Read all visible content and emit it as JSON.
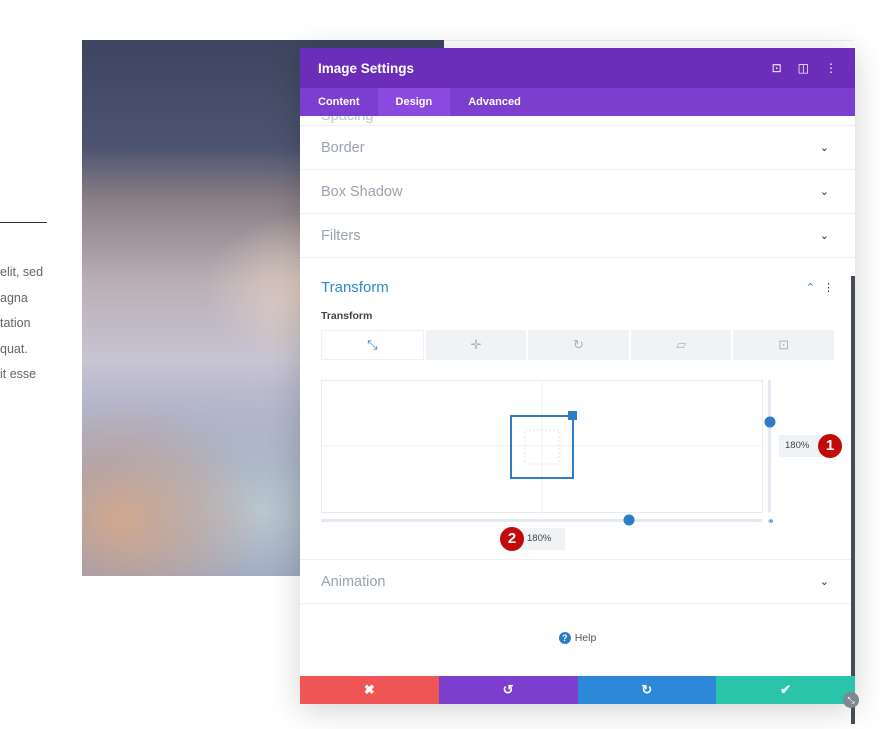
{
  "background": {
    "body_lines": [
      "elit, sed",
      "agna",
      "tation",
      "quat.",
      "it esse"
    ]
  },
  "modal": {
    "title": "Image Settings",
    "header_icons": [
      "focus-icon",
      "sidebar-layout-icon",
      "more-vertical-icon"
    ],
    "tabs": [
      {
        "label": "Content"
      },
      {
        "label": "Design",
        "active": true
      },
      {
        "label": "Advanced"
      }
    ],
    "sections": {
      "spacing": "Spacing",
      "border": "Border",
      "box_shadow": "Box Shadow",
      "filters": "Filters",
      "transform": "Transform",
      "animation": "Animation"
    },
    "transform": {
      "sub_label": "Transform",
      "tool_tabs": [
        "scale-icon",
        "translate-icon",
        "rotate-icon",
        "skew-icon",
        "origin-icon"
      ],
      "scale_y": "180%",
      "scale_x": "180%",
      "badge_1": "1",
      "badge_2": "2"
    },
    "help": "Help",
    "footer": {
      "cancel": "✖",
      "undo": "↺",
      "redo": "↻",
      "save": "✔"
    },
    "colors": {
      "header": "#6c2eb9",
      "tabs": "#7b3ecf",
      "accent": "#2e8acb",
      "cancel": "#ef5555",
      "undo": "#7b3ecf",
      "redo": "#2e88d9",
      "save": "#29c4a9"
    }
  }
}
